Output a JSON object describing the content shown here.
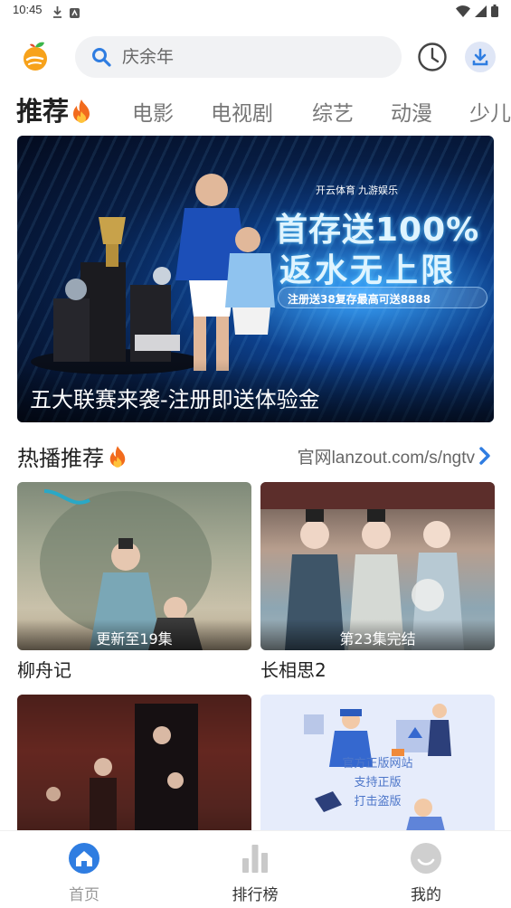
{
  "status_bar": {
    "time": "10:45"
  },
  "search": {
    "placeholder": "庆余年"
  },
  "tabs": [
    {
      "label": "推荐",
      "active": true
    },
    {
      "label": "电影"
    },
    {
      "label": "电视剧"
    },
    {
      "label": "综艺"
    },
    {
      "label": "动漫"
    },
    {
      "label": "少儿"
    }
  ],
  "banner": {
    "brand_line": "开云体育  九游娱乐",
    "headline_1": "首存送100%",
    "headline_2": "返水无上限",
    "subline": "注册送38复存最高可送8888",
    "caption": "五大联赛来袭-注册即送体验金"
  },
  "section": {
    "title": "热播推荐",
    "link": "官网lanzout.com/s/ngtv"
  },
  "cards": [
    {
      "badge": "更新至19集",
      "title": "柳舟记"
    },
    {
      "badge": "第23集完结",
      "title": "长相思2"
    },
    {
      "badge": "",
      "title": ""
    },
    {
      "poster_text": [
        "官方正版网站",
        "支持正版",
        "打击盗版"
      ]
    }
  ],
  "bottom_nav": [
    {
      "label": "首页",
      "active": true
    },
    {
      "label": "排行榜"
    },
    {
      "label": "我的"
    }
  ],
  "colors": {
    "accent_blue": "#2f7de1",
    "tab_inactive": "#777777",
    "search_bg": "#f1f2f4",
    "fire_orange": "#f26b1d",
    "logo_orange": "#f7a21b"
  },
  "icons": {
    "logo": "orange-logo-icon",
    "search": "search-icon",
    "history": "clock-icon",
    "download": "download-icon",
    "fire": "fire-icon",
    "arrow": "chevron-right-icon",
    "home": "home-icon",
    "ranking": "bar-chart-icon",
    "profile": "smiley-icon"
  }
}
